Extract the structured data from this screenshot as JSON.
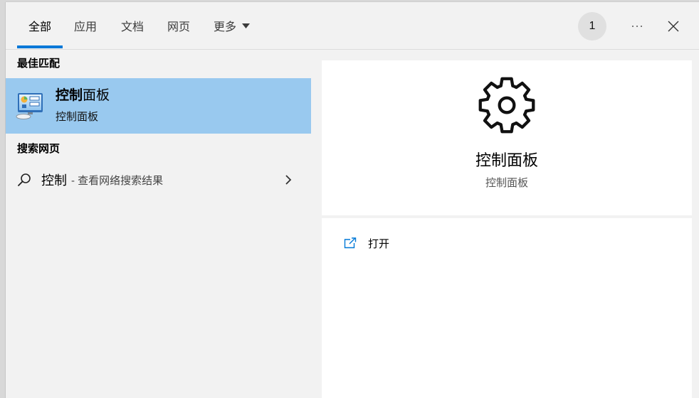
{
  "tabs": [
    {
      "label": "全部",
      "selected": true
    },
    {
      "label": "应用",
      "selected": false
    },
    {
      "label": "文档",
      "selected": false
    },
    {
      "label": "网页",
      "selected": false
    },
    {
      "label": "更多",
      "selected": false,
      "icon": "caret-down-icon"
    }
  ],
  "header": {
    "avatar_text": "1",
    "more_icon": "ellipsis-icon",
    "close_icon": "close-icon"
  },
  "results": {
    "best_match_heading": "最佳匹配",
    "best_match": {
      "icon": "control-panel-icon",
      "title_match": "控制",
      "title_rest": "面板",
      "subtitle": "控制面板",
      "selected": true
    },
    "web_heading": "搜索网页",
    "web_result": {
      "icon": "search-icon",
      "query": "控制",
      "suffix": "- 查看网络搜索结果",
      "chevron_icon": "chevron-right-icon"
    }
  },
  "preview": {
    "icon": "gear-icon",
    "title": "控制面板",
    "subtitle": "控制面板",
    "actions": [
      {
        "icon": "open-icon",
        "label": "打开"
      }
    ]
  },
  "colors": {
    "accent": "#0078d7",
    "selected_bg": "#99c9ef",
    "panel_bg": "#f2f2f2",
    "card_bg": "#ffffff"
  }
}
